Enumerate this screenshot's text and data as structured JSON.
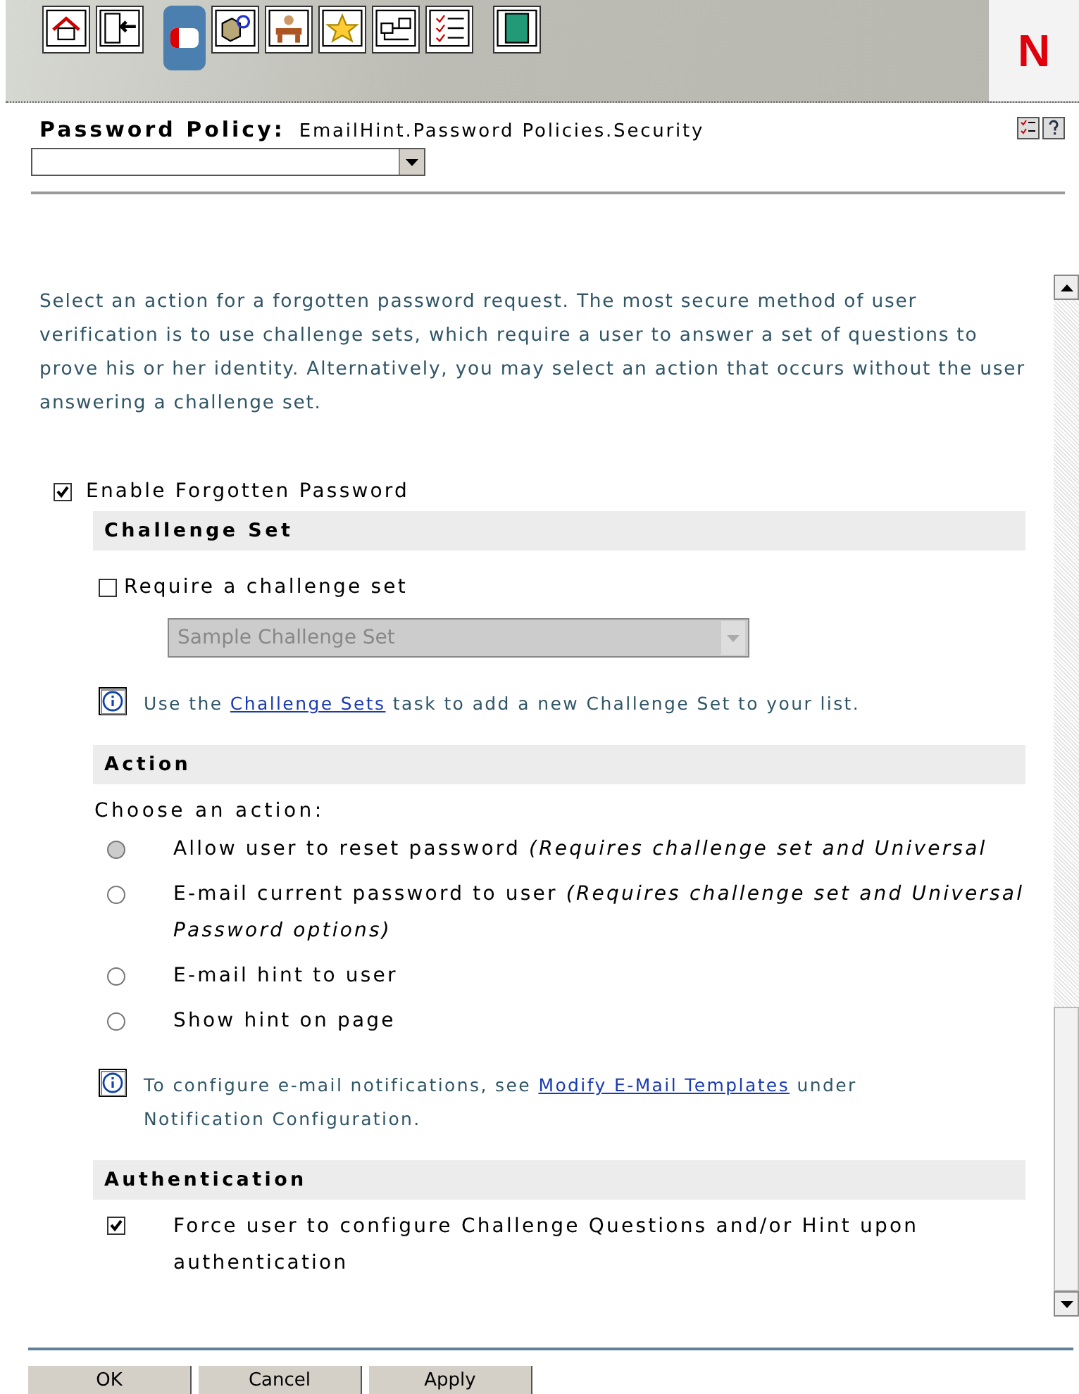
{
  "toolbar": [
    {
      "selected": false
    },
    {
      "selected": false
    },
    {
      "selected": true
    },
    {
      "selected": false
    },
    {
      "selected": false
    },
    {
      "selected": false
    },
    {
      "selected": false
    },
    {
      "selected": false
    },
    {
      "selected": false
    }
  ],
  "logo": "N",
  "header": {
    "label": "Password Policy:",
    "value": "EmailHint.Password Policies.Security"
  },
  "intro": "Select an action for a forgotten password request. The most secure method of user verification is to use challenge sets, which require a user to answer a set of questions to prove his or her identity. Alternatively, you may select an action that occurs without the user answering a challenge set.",
  "enable": {
    "label": "Enable Forgotten Password",
    "checked": true
  },
  "challenge_set": {
    "title": "Challenge Set",
    "require": {
      "label": "Require a challenge set",
      "checked": false
    },
    "select": {
      "value": "Sample Challenge Set",
      "disabled": true
    },
    "info": {
      "before": "Use the",
      "link": "Challenge Sets",
      "after": "task to add a new Challenge Set to your list."
    }
  },
  "action": {
    "title": "Action",
    "prompt": "Choose an action:",
    "options": [
      {
        "label": "Allow user to reset password *(Requires challenge set and Universal*",
        "selected": false,
        "disabled": true
      },
      {
        "label": "E-mail current password to user *(Requires challenge set and Universal Password options)*",
        "selected": false,
        "disabled": false
      },
      {
        "label": "E-mail hint to user",
        "selected": false,
        "disabled": false
      },
      {
        "label": "Show hint on page",
        "selected": false,
        "disabled": false
      }
    ],
    "info": {
      "before": "To configure e-mail notifications, see",
      "link": "Modify E-Mail Templates",
      "after": "under Notification Configuration."
    }
  },
  "authentication": {
    "title": "Authentication",
    "force": {
      "label": "Force user to configure Challenge Questions and/or Hint upon authentication",
      "checked": true
    }
  },
  "buttons": [
    "OK",
    "Cancel",
    "Apply"
  ]
}
